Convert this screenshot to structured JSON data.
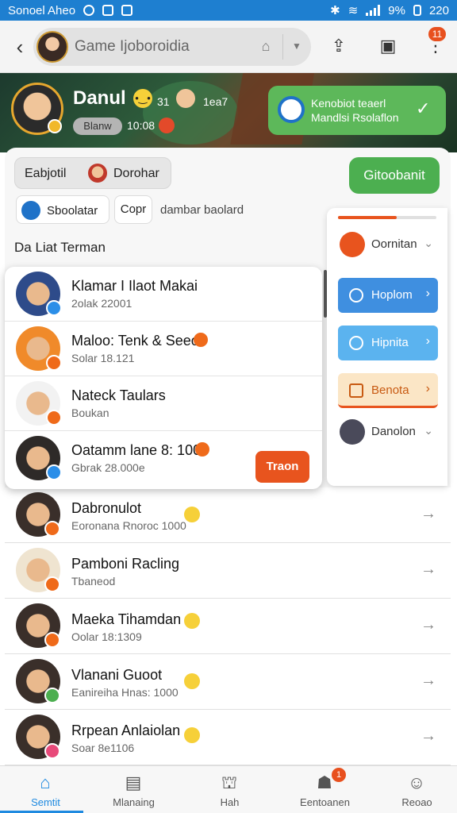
{
  "status_bar": {
    "left_text": "Sonoel Aheo",
    "battery": "9%",
    "time": "220"
  },
  "app_bar": {
    "search_text": "Game Ijoboroidia",
    "badge": "11"
  },
  "profile": {
    "name": "Danul",
    "mood_text": "31",
    "extra_text": "1ea7",
    "status_chip": "Blanw",
    "count": "10:08"
  },
  "notification": {
    "line1": "Kenobiot teaerl",
    "line2": "Mandlsi Rsolaflon"
  },
  "player_chip": {
    "left": "Eabjotil",
    "right": "Dorohar"
  },
  "green_button": "Gitoobanit",
  "filters": {
    "chip1": "Sboolatar",
    "chip2": "Copr",
    "text": "dambar baolard"
  },
  "section_title": "Da Liat Terman",
  "friends_top": [
    {
      "name": "Klamar I Ilaot Makai",
      "sub": "2olak 22001",
      "badge_color": "#2b8ee8"
    },
    {
      "name": "Maloo: Tenk & Seeo",
      "sub": "Solar 18.121",
      "badge_color": "#ef6a1a"
    },
    {
      "name": "Nateck Taulars",
      "sub": "Boukan",
      "badge_color": "#ef6a1a"
    },
    {
      "name": "Oatamm lane  8: 100",
      "sub": "Gbrak 28.000e",
      "badge_color": "#2b8ee8"
    }
  ],
  "orange_button": "Traon",
  "side_menu": {
    "progress": 0.6,
    "item_top": "Oornitan",
    "btn1": "Hoplom",
    "btn2": "Hipnita",
    "btn3": "Benota",
    "item_bottom": "Danolon"
  },
  "friends_bottom": [
    {
      "name": "Dabronulot",
      "sub": "Eoronana Rnoroc 1000",
      "badge_color": "#ef6a1a"
    },
    {
      "name": "Pamboni Racling",
      "sub": "Tbaneod",
      "badge_color": "#ef6a1a"
    },
    {
      "name": "Maeka Tihamdan",
      "sub": "Oolar 18:1309",
      "badge_color": "#ef6a1a"
    },
    {
      "name": "Vlanani Guoot",
      "sub": "Eanireiha Hnas: 1000",
      "badge_color": "#4caf50"
    },
    {
      "name": "Rrpean Anlaiolan",
      "sub": "Soar 8e1106",
      "badge_color": "#e84a7a"
    }
  ],
  "bottom_nav": [
    {
      "label": "Semtit",
      "icon": "home-icon"
    },
    {
      "label": "Mlanaing",
      "icon": "store-icon"
    },
    {
      "label": "Hah",
      "icon": "map-icon"
    },
    {
      "label": "Eentoanen",
      "icon": "friends-icon"
    },
    {
      "label": "Reoao",
      "icon": "person-icon"
    }
  ],
  "nav_badge": "1"
}
